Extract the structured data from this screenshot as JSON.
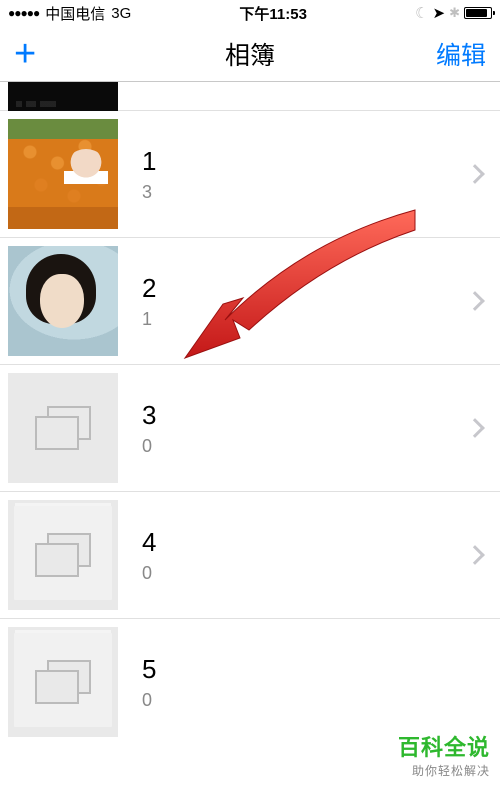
{
  "status": {
    "carrier": "中国电信",
    "network": "3G",
    "time": "下午11:53"
  },
  "nav": {
    "title": "相簿",
    "add": "+",
    "edit": "编辑"
  },
  "albums": [
    {
      "name": "1",
      "count": "3",
      "thumb": "flowers"
    },
    {
      "name": "2",
      "count": "1",
      "thumb": "portrait"
    },
    {
      "name": "3",
      "count": "0",
      "thumb": "empty"
    },
    {
      "name": "4",
      "count": "0",
      "thumb": "empty"
    },
    {
      "name": "5",
      "count": "0",
      "thumb": "empty"
    }
  ],
  "watermark": {
    "main": "百科全说",
    "sub": "助你轻松解决"
  }
}
